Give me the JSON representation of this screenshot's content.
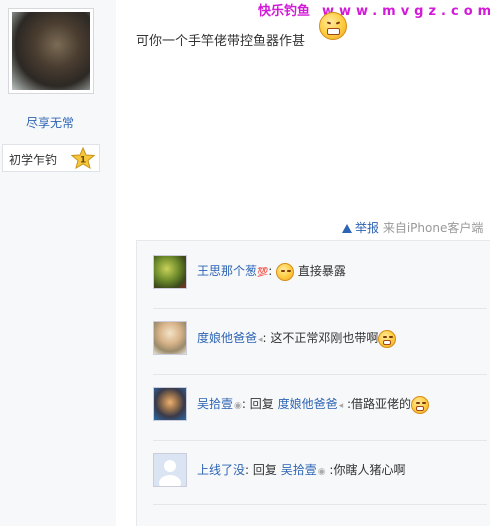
{
  "header": {
    "brand_cn": "快乐钓鱼",
    "brand_url": "www.mvgz.com"
  },
  "author": {
    "name": "尽享无常",
    "level_label": "初学乍钓",
    "level_num": "1"
  },
  "post": {
    "text": "可你一个手竿佬带控鱼器作甚",
    "report_label": "举报",
    "source_label": "来自iPhone客户端"
  },
  "comments": [
    {
      "user": "王思那个葱",
      "badge": "💯",
      "text": "直接暴露",
      "reply_to": ""
    },
    {
      "user": "度娘他爸爸",
      "badge": "",
      "text": "这不正常邓刚也带啊",
      "reply_to": ""
    },
    {
      "user": "吴拾壹",
      "badge": "",
      "reply_word": "回复",
      "reply_to": "度娘他爸爸",
      "text": ":借路亚佬的"
    },
    {
      "user": "上线了没",
      "badge": "",
      "reply_word": "回复",
      "reply_to": "吴拾壹",
      "text": ":你瞎人猪心啊"
    }
  ],
  "colors": {
    "link": "#2d64b3",
    "brand": "#d31ad8",
    "panel": "#f7f8fa"
  },
  "icons": [
    "laughing-emoji-icon",
    "smile-emoji-icon",
    "grin-emoji-icon",
    "star-level-icon",
    "warning-triangle-icon"
  ]
}
